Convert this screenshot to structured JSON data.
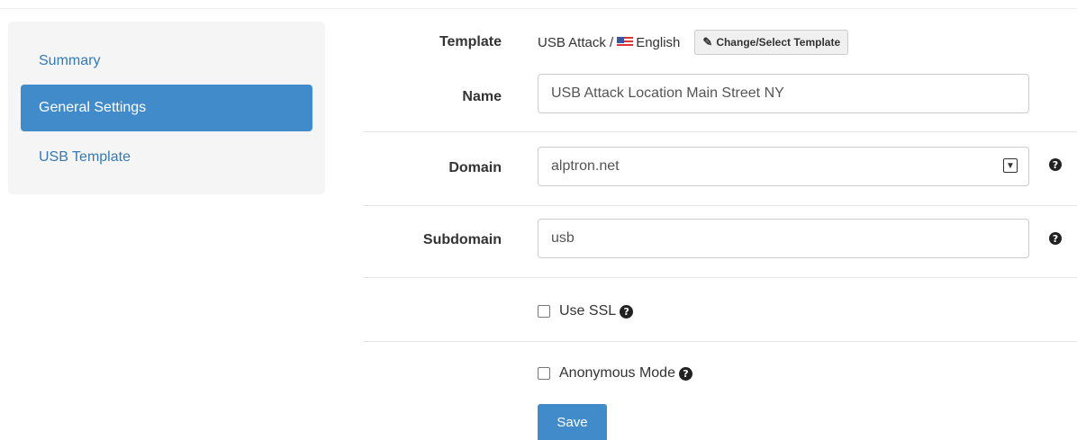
{
  "sidebar": {
    "items": [
      {
        "label": "Summary",
        "active": false
      },
      {
        "label": "General Settings",
        "active": true
      },
      {
        "label": "USB Template",
        "active": false
      }
    ]
  },
  "form": {
    "template": {
      "label": "Template",
      "value_prefix": "USB Attack /",
      "language": "English",
      "change_button": "Change/Select Template"
    },
    "name": {
      "label": "Name",
      "value": "USB Attack Location Main Street NY"
    },
    "domain": {
      "label": "Domain",
      "value": "alptron.net"
    },
    "subdomain": {
      "label": "Subdomain",
      "value": "usb"
    },
    "use_ssl": {
      "label": "Use SSL",
      "checked": false
    },
    "anonymous_mode": {
      "label": "Anonymous Mode",
      "checked": false
    },
    "save_label": "Save"
  },
  "colors": {
    "accent": "#428bca",
    "link": "#337ab7",
    "sidebar_bg": "#f5f5f5"
  }
}
